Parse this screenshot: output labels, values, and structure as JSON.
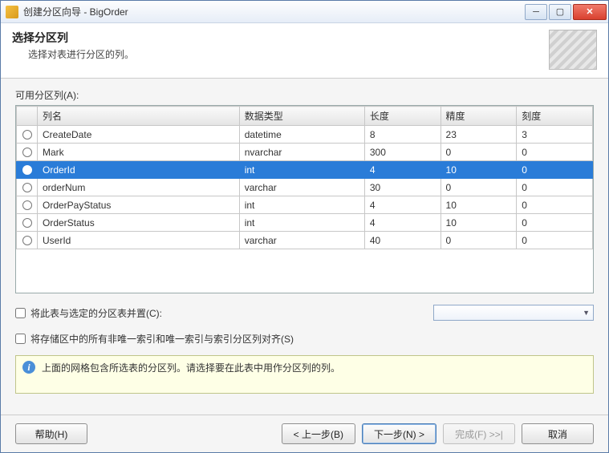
{
  "window": {
    "title": "创建分区向导 - BigOrder"
  },
  "header": {
    "title": "选择分区列",
    "subtitle": "选择对表进行分区的列。"
  },
  "grid": {
    "label": "可用分区列(A):",
    "headers": {
      "name": "列名",
      "type": "数据类型",
      "length": "长度",
      "precision": "精度",
      "scale": "刻度"
    },
    "rows": [
      {
        "name": "CreateDate",
        "type": "datetime",
        "length": "8",
        "precision": "23",
        "scale": "3",
        "selected": false
      },
      {
        "name": "Mark",
        "type": "nvarchar",
        "length": "300",
        "precision": "0",
        "scale": "0",
        "selected": false
      },
      {
        "name": "OrderId",
        "type": "int",
        "length": "4",
        "precision": "10",
        "scale": "0",
        "selected": true
      },
      {
        "name": "orderNum",
        "type": "varchar",
        "length": "30",
        "precision": "0",
        "scale": "0",
        "selected": false
      },
      {
        "name": "OrderPayStatus",
        "type": "int",
        "length": "4",
        "precision": "10",
        "scale": "0",
        "selected": false
      },
      {
        "name": "OrderStatus",
        "type": "int",
        "length": "4",
        "precision": "10",
        "scale": "0",
        "selected": false
      },
      {
        "name": "UserId",
        "type": "varchar",
        "length": "40",
        "precision": "0",
        "scale": "0",
        "selected": false
      }
    ]
  },
  "options": {
    "collocate": "将此表与选定的分区表并置(C):",
    "alignIndexes": "将存储区中的所有非唯一索引和唯一索引与索引分区列对齐(S)",
    "comboValue": ""
  },
  "info": {
    "message": "上面的网格包含所选表的分区列。请选择要在此表中用作分区列的列。"
  },
  "buttons": {
    "help": "帮助(H)",
    "back": "< 上一步(B)",
    "next": "下一步(N) >",
    "finish": "完成(F) >>|",
    "cancel": "取消"
  }
}
